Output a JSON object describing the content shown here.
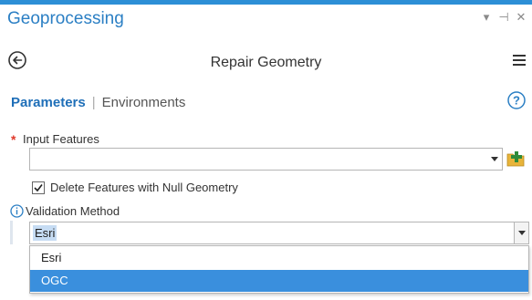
{
  "pane": {
    "title": "Geoprocessing",
    "controls": [
      "▾",
      "⊣",
      "✕"
    ]
  },
  "tool": {
    "title": "Repair Geometry"
  },
  "tabs": {
    "parameters": "Parameters",
    "separator": "|",
    "environments": "Environments"
  },
  "params": {
    "input_features": {
      "required_mark": "*",
      "label": "Input Features",
      "value": ""
    },
    "delete_null": {
      "label": "Delete Features with Null Geometry",
      "checked": true
    },
    "validation_method": {
      "label": "Validation Method",
      "value": "Esri",
      "options": [
        "Esri",
        "OGC"
      ],
      "highlighted_option": "OGC"
    }
  },
  "colors": {
    "accent": "#2b7fc4",
    "selected_option": "#3a8fdd",
    "required": "#e0392b",
    "folder": "#e8b43a"
  },
  "icons": {
    "back": "back-arrow-circle-icon",
    "menu": "hamburger-menu-icon",
    "help": "help-circle-icon",
    "info": "info-circle-icon",
    "browse": "add-folder-icon"
  }
}
